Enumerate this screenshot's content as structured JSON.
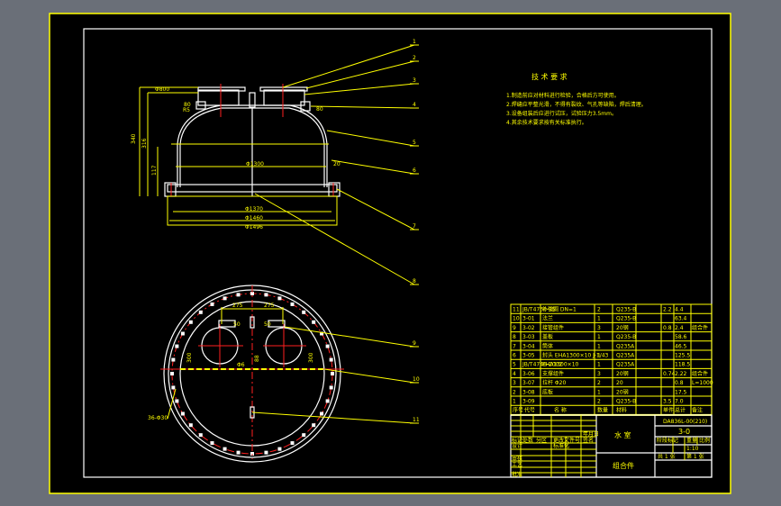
{
  "colors": {
    "background": "#6a6f78",
    "canvas": "#000000",
    "frame": "#ffff00",
    "outline": "#ffffff",
    "centerline": "#ff2020"
  },
  "notes": {
    "title": "技 术 要 求",
    "lines": [
      "1.制造前应对材料进行检验，合格后方可使用。",
      "2.焊缝应平整光滑，不得有裂纹、气孔等缺陷，焊后清理。",
      "3.设备组装后应进行试压，试验压力3.5mm。",
      "4.其余技术要求按有关标准执行。"
    ]
  },
  "elevation": {
    "dims": {
      "top_flange": "Φ800",
      "height_total": "340",
      "height_inner": "316",
      "height_shell": "117",
      "dome_r": "R5",
      "nozzle_left": "80",
      "nozzle_right": "80",
      "inner_dia": "Φ1300",
      "wall": "20",
      "dia_1": "Φ1370",
      "dia_2": "Φ1460",
      "dia_3": "Φ1496"
    }
  },
  "plan": {
    "dims": {
      "left_offset": "275",
      "right_offset": "275",
      "left_h": "300",
      "right_h": "300",
      "small_left": "50",
      "small_right": "50",
      "center": "88",
      "bolt": "36-Φ30",
      "center_note": "Φ6"
    }
  },
  "callouts": [
    "1",
    "2",
    "3",
    "4",
    "5",
    "6",
    "7",
    "8",
    "9",
    "10",
    "11"
  ],
  "parts": {
    "rows": [
      [
        "11",
        "JB/T4736-95",
        "补强圈 DN=1",
        "2",
        "Q235-B",
        "2.2",
        "4.4",
        ""
      ],
      [
        "10",
        "3-01",
        "法兰",
        "1",
        "Q235-B",
        "",
        "63.4",
        ""
      ],
      [
        "9",
        "3-02",
        "接管组件",
        "3",
        "20钢",
        "0.8",
        "2.4",
        "组合件"
      ],
      [
        "8",
        "3-03",
        "盖板",
        "1",
        "Q235-B",
        "",
        "58.6",
        ""
      ],
      [
        "7",
        "3-04",
        "筒体",
        "1",
        "Q235A",
        "",
        "46.5",
        ""
      ],
      [
        "6",
        "3-05",
        "封头 EHA1300×10 J-1/43",
        "1",
        "Q235A",
        "",
        "125.5",
        ""
      ],
      [
        "5",
        "JB/T4746-2002",
        "EHA1300×10",
        "1",
        "Q235A",
        "",
        "118.5",
        ""
      ],
      [
        "4",
        "3-06",
        "支撑组件",
        "3",
        "20钢",
        "0.74",
        "2.22",
        "组合件"
      ],
      [
        "3",
        "3-07",
        "拉杆 Φ20",
        "2",
        "20",
        "",
        "0.8",
        "L=1000"
      ],
      [
        "2",
        "3-08",
        "底板",
        "1",
        "20钢",
        "",
        "17.5",
        ""
      ],
      [
        "1",
        "3-09",
        "",
        "2",
        "Q235-B",
        "3.5",
        "7.0",
        ""
      ]
    ],
    "header": [
      "序号",
      "代号",
      "名 称",
      "数量",
      "材料",
      "单件",
      "总计",
      "备注"
    ],
    "header_sub": "质量"
  },
  "title_block": {
    "drawing_no": "DA836L-00(210)",
    "part_no": "3-0",
    "name": "水 室",
    "subtitle": "组合件",
    "labels": [
      "标记",
      "处数",
      "分区",
      "更改文件号",
      "签名",
      "年月日",
      "设计",
      "标准化",
      "审核",
      "工艺",
      "批准"
    ],
    "stage": "阶段标记",
    "weight": "重量",
    "scale": "比例",
    "weight_value": "1:10",
    "sheets": "共 1 张",
    "sheet": "第 1 张"
  }
}
